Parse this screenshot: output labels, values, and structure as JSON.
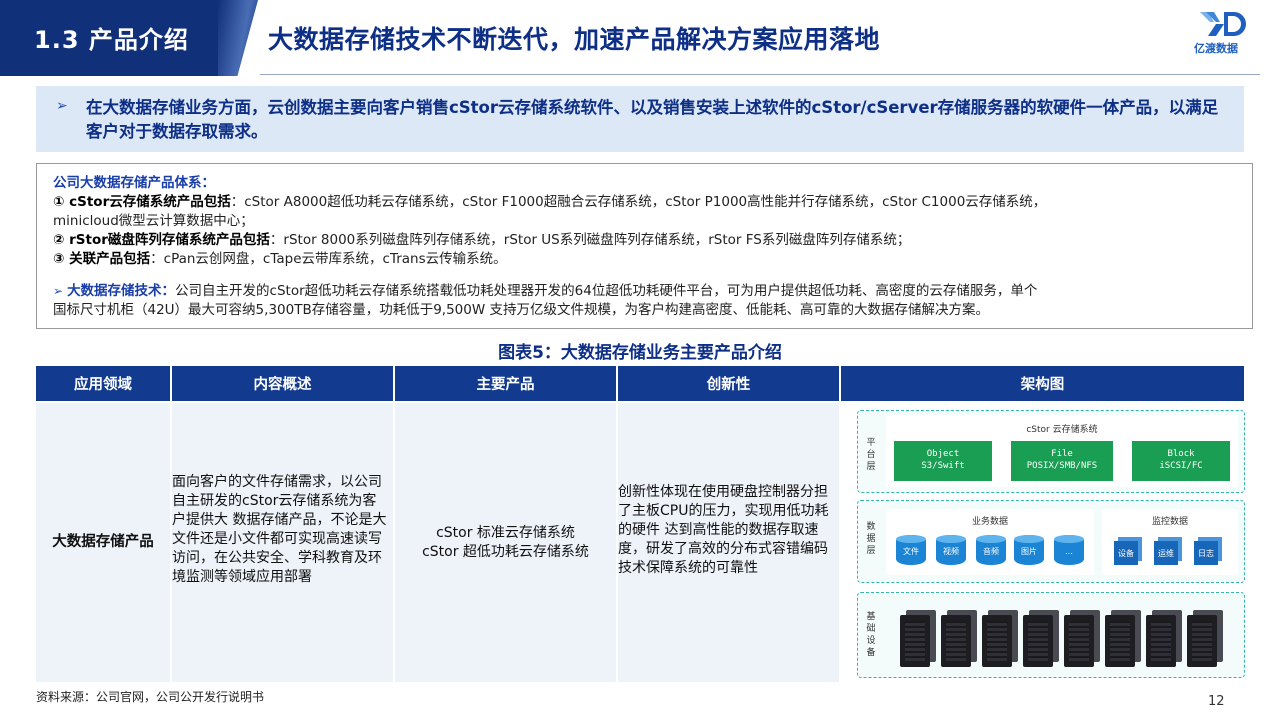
{
  "header": {
    "section_label": "1.3 产品介绍",
    "page_title": "大数据存储技术不断迭代，加速产品解决方案应用落地",
    "logo_text": "亿渡数据",
    "brand_color": "#11307a"
  },
  "summary": {
    "arrow": "➢",
    "text": "在大数据存储业务方面，云创数据主要向客户销售cStor云存储系统软件、以及销售安装上述软件的cStor/cServer存储服务器的软硬件一体产品，以满足客户对于数据存取需求。"
  },
  "detail": {
    "heading": "公司大数据存储产品体系：",
    "item1_label": "① cStor云存储系统产品包括",
    "item1_text": "：cStor A8000超低功耗云存储系统，cStor F1000超融合云存储系统，cStor P1000高性能并行存储系统，cStor C1000云存储系统，",
    "item1_text_cont": "minicloud微型云计算数据中心；",
    "item2_label": "② rStor磁盘阵列存储系统产品包括",
    "item2_text": "：rStor 8000系列磁盘阵列存储系统，rStor US系列磁盘阵列存储系统，rStor FS系列磁盘阵列存储系统；",
    "item3_label": "③ 关联产品包括",
    "item3_text": "：cPan云创网盘，cTape云带库系统，cTrans云传输系统。",
    "tech_arrow": "➢",
    "tech_label": "大数据存储技术：",
    "tech_text": "公司自主开发的cStor超低功耗云存储系统搭载低功耗处理器开发的64位超低功耗硬件平台，可为用户提供超低功耗、高密度的云存储服务，单个",
    "tech_text_cont": "国标尺寸机柜（42U）最大可容纳5,300TB存储容量，功耗低于9,500W 支持万亿级文件规模，为客户构建高密度、低能耗、高可靠的大数据存储解决方案。"
  },
  "table": {
    "caption": "图表5：大数据存储业务主要产品介绍",
    "headers": [
      "应用领域",
      "内容概述",
      "主要产品",
      "创新性",
      "架构图"
    ],
    "row": {
      "field": "大数据存储产品",
      "overview": "面向客户的文件存储需求，以公司自主研发的cStor云存储系统为客户提供大 数据存储产品，不论是大文件还是小文件都可实现高速读写访问，在公共安全、学科教育及环境监测等领域应用部署",
      "products_line1": "cStor 标准云存储系统",
      "products_line2": "cStor 超低功耗云存储系统",
      "innovation": "创新性体现在使用硬盘控制器分担了主板CPU的压力，实现用低功耗的硬件 达到高性能的数据存取速度，研发了高效的分布式容错编码技术保障系统的可靠性"
    }
  },
  "diagram": {
    "platform_label": "平台层",
    "platform_title": "cStor 云存储系统",
    "platform_boxes": [
      {
        "line1": "Object",
        "line2": "S3/Swift"
      },
      {
        "line1": "File",
        "line2": "POSIX/SMB/NFS"
      },
      {
        "line1": "Block",
        "line2": "iSCSI/FC"
      }
    ],
    "data_label": "数据层",
    "business_title": "业务数据",
    "business_items": [
      "文件",
      "视频",
      "音频",
      "图片",
      "…"
    ],
    "monitor_title": "监控数据",
    "monitor_items": [
      "设备",
      "运维",
      "日志"
    ],
    "infra_label": "基础设备",
    "server_count": 8,
    "accent": "#33b7a8",
    "green": "#1a9e53",
    "blue": "#1b84d4"
  },
  "footer": {
    "source": "资料来源：公司官网，公司公开发行说明书",
    "page_number": "12"
  }
}
